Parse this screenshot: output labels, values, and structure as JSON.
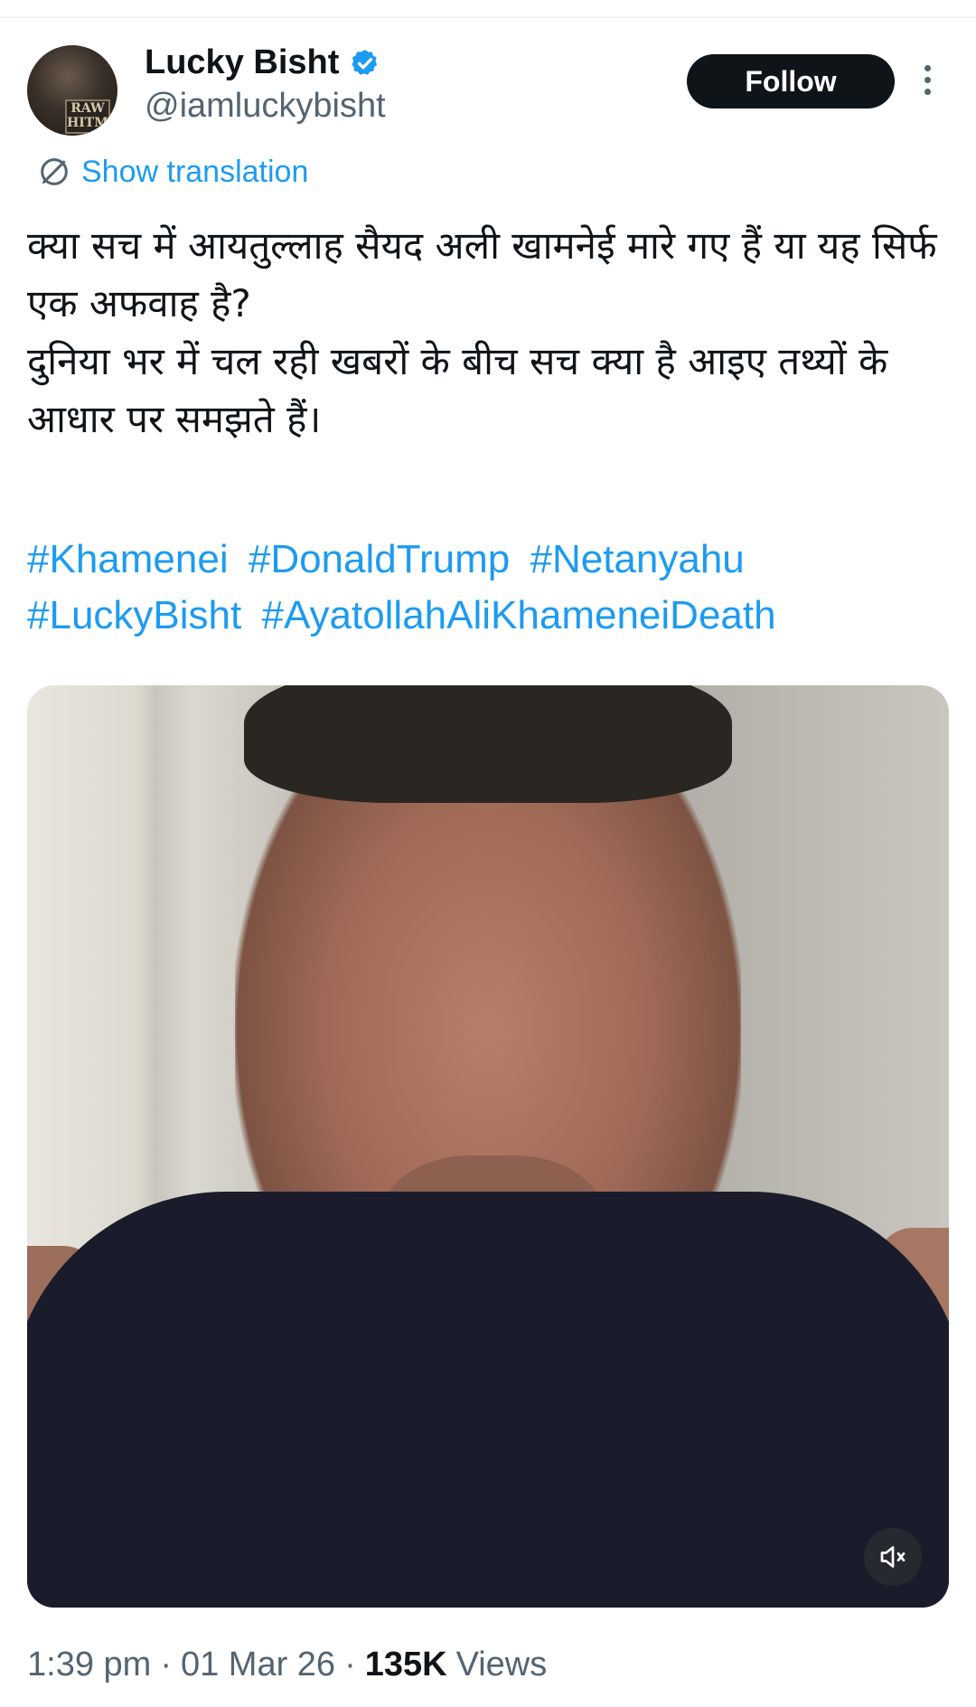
{
  "author": {
    "name": "Lucky Bisht",
    "handle": "@iamluckybisht",
    "avatar_badge": "RAW\nHITMAN",
    "verified": true
  },
  "actions": {
    "follow_label": "Follow",
    "more_icon": "more-vertical-icon"
  },
  "translation": {
    "label": "Show translation",
    "icon": "translate-icon"
  },
  "tweet": {
    "line1": "क्या सच में आयतुल्लाह सैयद अली खामनेई मारे गए हैं या यह सिर्फ एक अफवाह है?",
    "line2": "दुनिया भर में चल रही खबरों के बीच सच क्या है आइए तथ्यों के आधार पर समझते हैं।",
    "hashtags": [
      "#Khamenei",
      "#DonaldTrump",
      "#Netanyahu",
      "#LuckyBisht",
      "#AyatollahAliKhameneiDeath"
    ]
  },
  "media": {
    "type": "video",
    "mute_icon": "muted-speaker-icon"
  },
  "meta": {
    "time": "1:39 pm",
    "date": "01 Mar 26",
    "views_count": "135K",
    "views_label": "Views"
  },
  "colors": {
    "accent": "#1d9bf0",
    "text": "#0f1419",
    "secondary": "#536471",
    "follow_bg": "#0f1419"
  }
}
